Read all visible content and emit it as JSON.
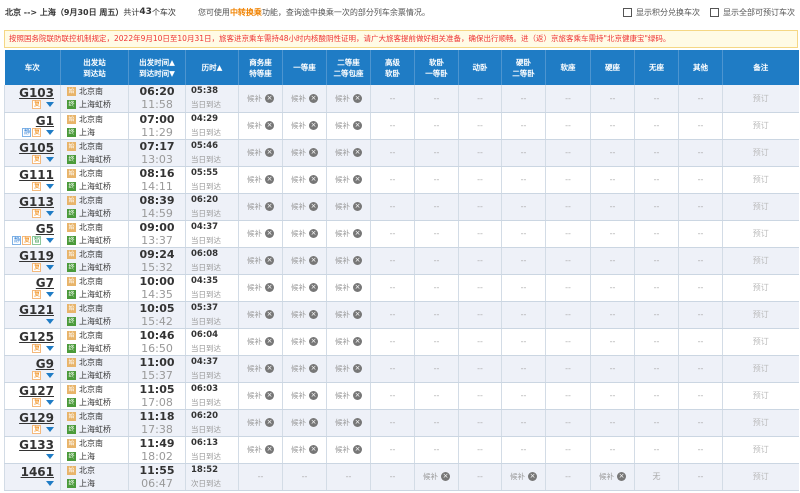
{
  "topbar": {
    "route": "北京 --> 上海（9月30日 周五）",
    "count_prefix": "共计",
    "count": "43",
    "count_suffix": "个车次",
    "hint_prefix": "您可使用",
    "hint_link": "中转换乘",
    "hint_suffix": "功能，查询途中换乘一次的部分列车余票情况。",
    "check1": "显示积分兑换车次",
    "check2": "显示全部可预订车次"
  },
  "alert": "按照国务院联防联控机制规定，2022年9月10日至10月31日，旅客进京乘车需持48小时内核酸阴性证明，请广大旅客提前做好相关准备，确保出行顺畅。进（返）京旅客乘车需持\"北京健康宝\"绿码。",
  "headers": [
    [
      "车次"
    ],
    [
      "出发站",
      "到达站"
    ],
    [
      "出发时间▲",
      "到达时间▼"
    ],
    [
      "历时▲"
    ],
    [
      "商务座",
      "特等座"
    ],
    [
      "一等座"
    ],
    [
      "二等座",
      "二等包座"
    ],
    [
      "高级",
      "软卧"
    ],
    [
      "软卧",
      "一等卧"
    ],
    [
      "动卧"
    ],
    [
      "硬卧",
      "二等卧"
    ],
    [
      "软座"
    ],
    [
      "硬座"
    ],
    [
      "无座"
    ],
    [
      "其他"
    ],
    [
      "备注"
    ]
  ],
  "book_label": "预订",
  "colors": {
    "header": "#1f7cc5",
    "alt_row": "#eef1f8",
    "alert_text": "#ee3333",
    "highlight": "#f08200"
  },
  "trains": [
    {
      "no": "G103",
      "badges": [
        "复"
      ],
      "from": "北京南",
      "to": "上海虹桥",
      "dep": "06:20",
      "arr": "11:58",
      "dur": "05:38",
      "day": "当日到达",
      "seats": [
        "候补",
        "候补",
        "候补",
        "--",
        "--",
        "--",
        "--",
        "--",
        "--",
        "--",
        "--"
      ]
    },
    {
      "no": "G1",
      "badges": [
        "静",
        "复"
      ],
      "from": "北京南",
      "to": "上海",
      "dep": "07:00",
      "arr": "11:29",
      "dur": "04:29",
      "day": "当日到达",
      "seats": [
        "候补",
        "候补",
        "候补",
        "--",
        "--",
        "--",
        "--",
        "--",
        "--",
        "--",
        "--"
      ]
    },
    {
      "no": "G105",
      "badges": [
        "复"
      ],
      "from": "北京南",
      "to": "上海虹桥",
      "dep": "07:17",
      "arr": "13:03",
      "dur": "05:46",
      "day": "当日到达",
      "seats": [
        "候补",
        "候补",
        "候补",
        "--",
        "--",
        "--",
        "--",
        "--",
        "--",
        "--",
        "--"
      ]
    },
    {
      "no": "G111",
      "badges": [
        "复"
      ],
      "from": "北京南",
      "to": "上海虹桥",
      "dep": "08:16",
      "arr": "14:11",
      "dur": "05:55",
      "day": "当日到达",
      "seats": [
        "候补",
        "候补",
        "候补",
        "--",
        "--",
        "--",
        "--",
        "--",
        "--",
        "--",
        "--"
      ]
    },
    {
      "no": "G113",
      "badges": [
        "复"
      ],
      "from": "北京南",
      "to": "上海虹桥",
      "dep": "08:39",
      "arr": "14:59",
      "dur": "06:20",
      "day": "当日到达",
      "seats": [
        "候补",
        "候补",
        "候补",
        "--",
        "--",
        "--",
        "--",
        "--",
        "--",
        "--",
        "--"
      ]
    },
    {
      "no": "G5",
      "badges": [
        "静",
        "复",
        "智"
      ],
      "from": "北京南",
      "to": "上海虹桥",
      "dep": "09:00",
      "arr": "13:37",
      "dur": "04:37",
      "day": "当日到达",
      "seats": [
        "候补",
        "候补",
        "候补",
        "--",
        "--",
        "--",
        "--",
        "--",
        "--",
        "--",
        "--"
      ]
    },
    {
      "no": "G119",
      "badges": [
        "复"
      ],
      "from": "北京南",
      "to": "上海虹桥",
      "dep": "09:24",
      "arr": "15:32",
      "dur": "06:08",
      "day": "当日到达",
      "seats": [
        "候补",
        "候补",
        "候补",
        "--",
        "--",
        "--",
        "--",
        "--",
        "--",
        "--",
        "--"
      ]
    },
    {
      "no": "G7",
      "badges": [
        "复"
      ],
      "from": "北京南",
      "to": "上海虹桥",
      "dep": "10:00",
      "arr": "14:35",
      "dur": "04:35",
      "day": "当日到达",
      "seats": [
        "候补",
        "候补",
        "候补",
        "--",
        "--",
        "--",
        "--",
        "--",
        "--",
        "--",
        "--"
      ]
    },
    {
      "no": "G121",
      "badges": [],
      "from": "北京南",
      "to": "上海虹桥",
      "dep": "10:05",
      "arr": "15:42",
      "dur": "05:37",
      "day": "当日到达",
      "seats": [
        "候补",
        "候补",
        "候补",
        "--",
        "--",
        "--",
        "--",
        "--",
        "--",
        "--",
        "--"
      ]
    },
    {
      "no": "G125",
      "badges": [
        "复"
      ],
      "from": "北京南",
      "to": "上海虹桥",
      "dep": "10:46",
      "arr": "16:50",
      "dur": "06:04",
      "day": "当日到达",
      "seats": [
        "候补",
        "候补",
        "候补",
        "--",
        "--",
        "--",
        "--",
        "--",
        "--",
        "--",
        "--"
      ]
    },
    {
      "no": "G9",
      "badges": [
        "复"
      ],
      "from": "北京南",
      "to": "上海虹桥",
      "dep": "11:00",
      "arr": "15:37",
      "dur": "04:37",
      "day": "当日到达",
      "seats": [
        "候补",
        "候补",
        "候补",
        "--",
        "--",
        "--",
        "--",
        "--",
        "--",
        "--",
        "--"
      ]
    },
    {
      "no": "G127",
      "badges": [
        "复"
      ],
      "from": "北京南",
      "to": "上海虹桥",
      "dep": "11:05",
      "arr": "17:08",
      "dur": "06:03",
      "day": "当日到达",
      "seats": [
        "候补",
        "候补",
        "候补",
        "--",
        "--",
        "--",
        "--",
        "--",
        "--",
        "--",
        "--"
      ]
    },
    {
      "no": "G129",
      "badges": [
        "复"
      ],
      "from": "北京南",
      "to": "上海虹桥",
      "dep": "11:18",
      "arr": "17:38",
      "dur": "06:20",
      "day": "当日到达",
      "seats": [
        "候补",
        "候补",
        "候补",
        "--",
        "--",
        "--",
        "--",
        "--",
        "--",
        "--",
        "--"
      ]
    },
    {
      "no": "G133",
      "badges": [],
      "from": "北京南",
      "to": "上海",
      "dep": "11:49",
      "arr": "18:02",
      "dur": "06:13",
      "day": "当日到达",
      "seats": [
        "候补",
        "候补",
        "候补",
        "--",
        "--",
        "--",
        "--",
        "--",
        "--",
        "--",
        "--"
      ]
    },
    {
      "no": "1461",
      "badges": [],
      "from": "北京",
      "to": "上海",
      "dep": "11:55",
      "arr": "06:47",
      "dur": "18:52",
      "day": "次日到达",
      "seats": [
        "--",
        "--",
        "--",
        "--",
        "候补",
        "--",
        "候补",
        "--",
        "候补",
        "无",
        "--"
      ]
    }
  ]
}
